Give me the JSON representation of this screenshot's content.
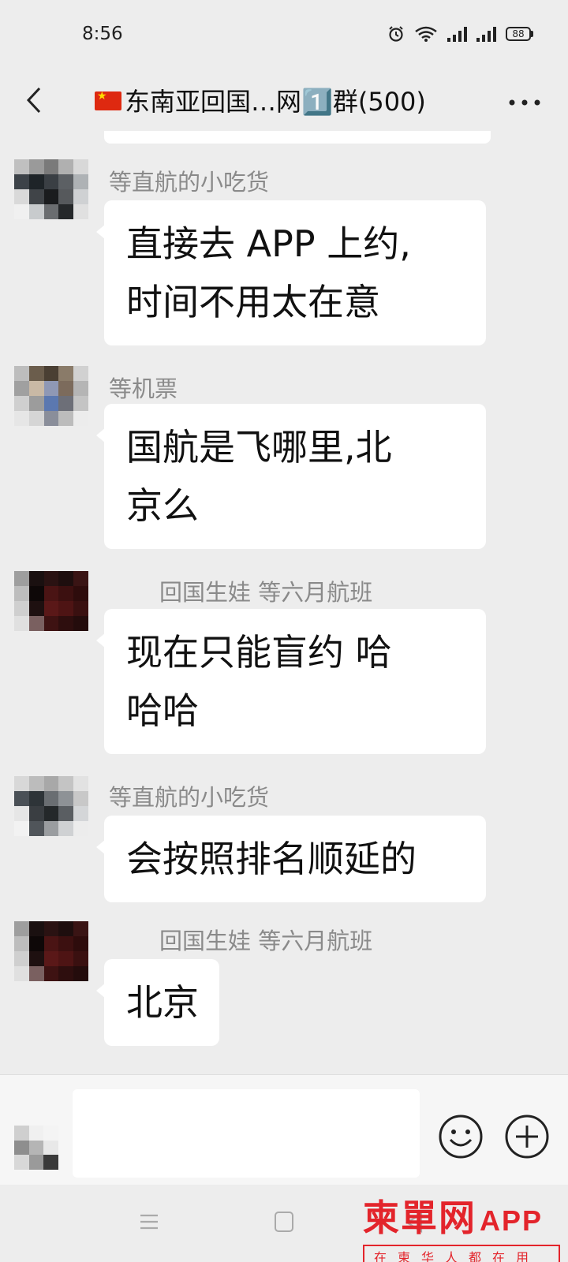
{
  "status_bar": {
    "time": "8:56",
    "battery": "88",
    "icons": [
      "alarm-icon",
      "wifi-icon",
      "signal-icon",
      "signal-icon",
      "battery-icon"
    ]
  },
  "header": {
    "title": "东南亚回国…网1️⃣群(500)",
    "back_icon": "chevron-left-icon",
    "more_icon": "more-dots-icon"
  },
  "messages": [
    {
      "sender": "等直航的小吃货",
      "lines": [
        "直接去 APP 上约,",
        "时间不用太在意"
      ],
      "avatar_colors": [
        "#c0c0c0",
        "#9a9a9a",
        "#7a7a7a",
        "#b0b0b0",
        "#d8d8d8",
        "#3c4248",
        "#1e2428",
        "#3a3f44",
        "#5c6064",
        "#aeb2b5",
        "#d9d9d9",
        "#404448",
        "#1a1c1e",
        "#56595c",
        "#cfd1d3",
        "#f0f0f0",
        "#c8cbcd",
        "#6a6d70",
        "#25282a",
        "#e0e0e0"
      ]
    },
    {
      "sender": "等机票",
      "lines": [
        "国航是飞哪里,北",
        "京么"
      ],
      "avatar_colors": [
        "#bdbdbd",
        "#6b5d4c",
        "#4a3f33",
        "#8a7b69",
        "#d1d1d1",
        "#a0a0a0",
        "#c9b9a5",
        "#8f98b5",
        "#7c6b5c",
        "#b5b5b5",
        "#cfcfcf",
        "#9c9c9c",
        "#5b78b0",
        "#6d6f78",
        "#c4c4c4",
        "#e6e6e6",
        "#d5d5d5",
        "#8a8e9a",
        "#bcbcbc",
        "#ececec"
      ]
    },
    {
      "sender": "回国生娃 等六月航班",
      "lines": [
        "现在只能盲约 哈",
        "哈哈"
      ],
      "avatar_colors": [
        "#9e9e9e",
        "#1a1010",
        "#2a1212",
        "#1e0e0e",
        "#3a1414",
        "#bdbdbd",
        "#0e0808",
        "#4a1414",
        "#3c1010",
        "#2e0c0c",
        "#cfcfcf",
        "#1e1010",
        "#5a1818",
        "#4e1414",
        "#3a1010",
        "#e0e0e0",
        "#7a6060",
        "#3e1212",
        "#2e0e0e",
        "#240c0c"
      ]
    },
    {
      "sender": "等直航的小吃货",
      "lines": [
        "会按照排名顺延的"
      ],
      "avatar_colors": [
        "#d8d8d8",
        "#bcbcbc",
        "#a8a8a8",
        "#c4c4c4",
        "#e2e2e2",
        "#4a5056",
        "#2e3438",
        "#6a6e72",
        "#8e9296",
        "#c8c8c8",
        "#e6e6e6",
        "#3a3e42",
        "#24282a",
        "#5a5e62",
        "#d4d6d8",
        "#f2f2f2",
        "#50555a",
        "#9a9da0",
        "#cfd1d3",
        "#ececec"
      ]
    },
    {
      "sender": "回国生娃 等六月航班",
      "lines": [
        "北京"
      ],
      "avatar_colors": [
        "#9e9e9e",
        "#1a1010",
        "#2a1212",
        "#1e0e0e",
        "#3a1414",
        "#bdbdbd",
        "#0e0808",
        "#4a1414",
        "#3c1010",
        "#2e0c0c",
        "#cfcfcf",
        "#1e1010",
        "#5a1818",
        "#4e1414",
        "#3a1010",
        "#e0e0e0",
        "#7a6060",
        "#3e1212",
        "#2e0e0e",
        "#240c0c"
      ]
    }
  ],
  "input_bar": {
    "placeholder": "",
    "emoji_icon": "emoji-icon",
    "plus_icon": "plus-circle-icon",
    "avatar_colors": [
      "#cfcfcf",
      "#f0f0f0",
      "#f4f4f4",
      "#8e8e8e",
      "#b5b5b5",
      "#e8e8e8",
      "#d8d8d8",
      "#9a9a9a",
      "#3a3a3a"
    ]
  },
  "nav_bar": {
    "icons": [
      "menu-icon",
      "home-icon",
      "back-icon"
    ]
  },
  "watermark": {
    "brand": "柬單网",
    "app": "APP",
    "slogan": "在柬华人都在用",
    "color": "#e3242b"
  }
}
